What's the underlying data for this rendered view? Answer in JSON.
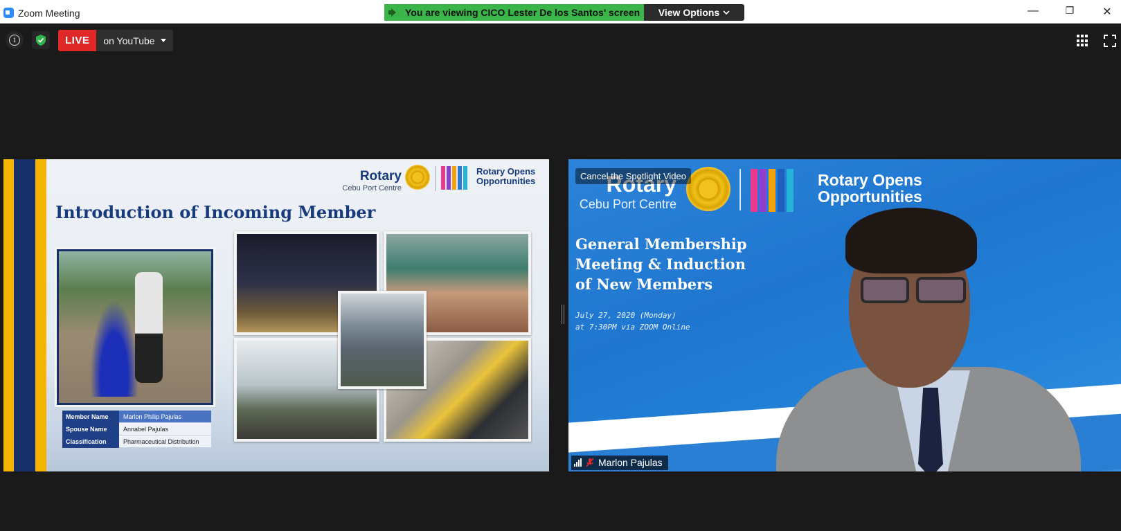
{
  "window": {
    "title": "Zoom Meeting",
    "banner_text": "You are viewing CICO Lester De los Santos' screen",
    "view_options_label": "View Options",
    "minimize_glyph": "—",
    "restore_glyph": "❐",
    "close_glyph": "✕"
  },
  "toolbar": {
    "live_label": "LIVE",
    "stream_destination": "on YouTube"
  },
  "shared_slide": {
    "org_name": "Rotary",
    "club_name": "Cebu Port Centre",
    "campaign_line1": "Rotary Opens",
    "campaign_line2": "Opportunities",
    "title": "Introduction of Incoming Member",
    "member_details": [
      {
        "label": "Member Name",
        "value": "Marlon Philip Pajulas"
      },
      {
        "label": "Spouse Name",
        "value": "Annabel Pajulas"
      },
      {
        "label": "Classification",
        "value": "Pharmaceutical Distribution"
      }
    ]
  },
  "speaker_video": {
    "spotlight_label": "Cancel the Spotlight Video",
    "org_name": "Rotary",
    "club_name": "Cebu Port Centre",
    "campaign_line1": "Rotary Opens",
    "campaign_line2": "Opportunities",
    "event_line1": "General Membership",
    "event_line2": "Meeting & Induction",
    "event_line3": "of New Members",
    "date_line": "July 27, 2020 (Monday)",
    "time_line": "at 7:30PM via ZOOM Online",
    "participant_name": "Marlon Pajulas"
  },
  "colors": {
    "live_red": "#e02828",
    "banner_green": "#3bb44a",
    "rotary_blue": "#173a7c",
    "rotary_gold": "#f1c21b"
  }
}
